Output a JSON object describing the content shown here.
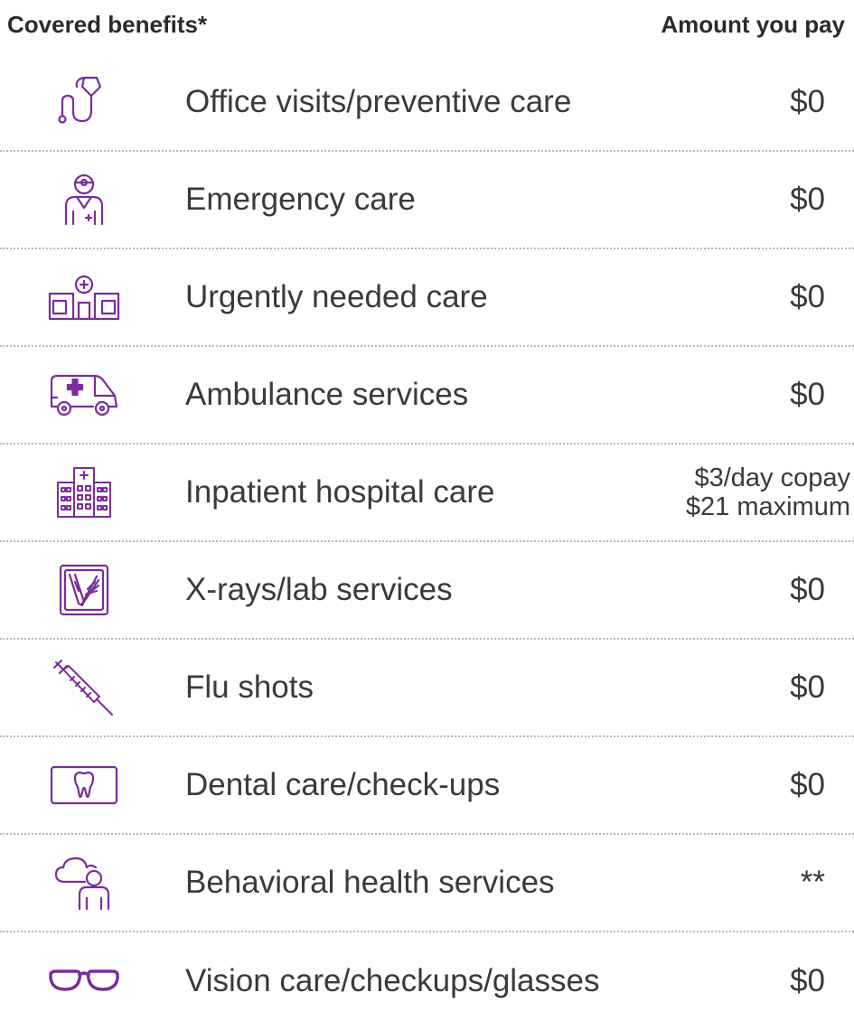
{
  "header": {
    "left": "Covered benefits*",
    "right": "Amount you pay"
  },
  "accent_color": "#7b2c9b",
  "rows": [
    {
      "icon": "stethoscope-icon",
      "benefit": "Office visits/preventive care",
      "amount": "$0"
    },
    {
      "icon": "doctor-icon",
      "benefit": "Emergency care",
      "amount": "$0"
    },
    {
      "icon": "clinic-building-icon",
      "benefit": "Urgently needed care",
      "amount": "$0"
    },
    {
      "icon": "ambulance-icon",
      "benefit": "Ambulance services",
      "amount": "$0"
    },
    {
      "icon": "hospital-icon",
      "benefit": "Inpatient hospital care",
      "amount_line1": "$3/day copay",
      "amount_line2": "$21 maximum"
    },
    {
      "icon": "xray-icon",
      "benefit": "X-rays/lab services",
      "amount": "$0"
    },
    {
      "icon": "syringe-icon",
      "benefit": "Flu shots",
      "amount": "$0"
    },
    {
      "icon": "tooth-icon",
      "benefit": "Dental care/check-ups",
      "amount": "$0"
    },
    {
      "icon": "behavioral-health-icon",
      "benefit": "Behavioral health services",
      "amount": "**"
    },
    {
      "icon": "eyeglasses-icon",
      "benefit": "Vision care/checkups/glasses",
      "amount": "$0"
    }
  ]
}
